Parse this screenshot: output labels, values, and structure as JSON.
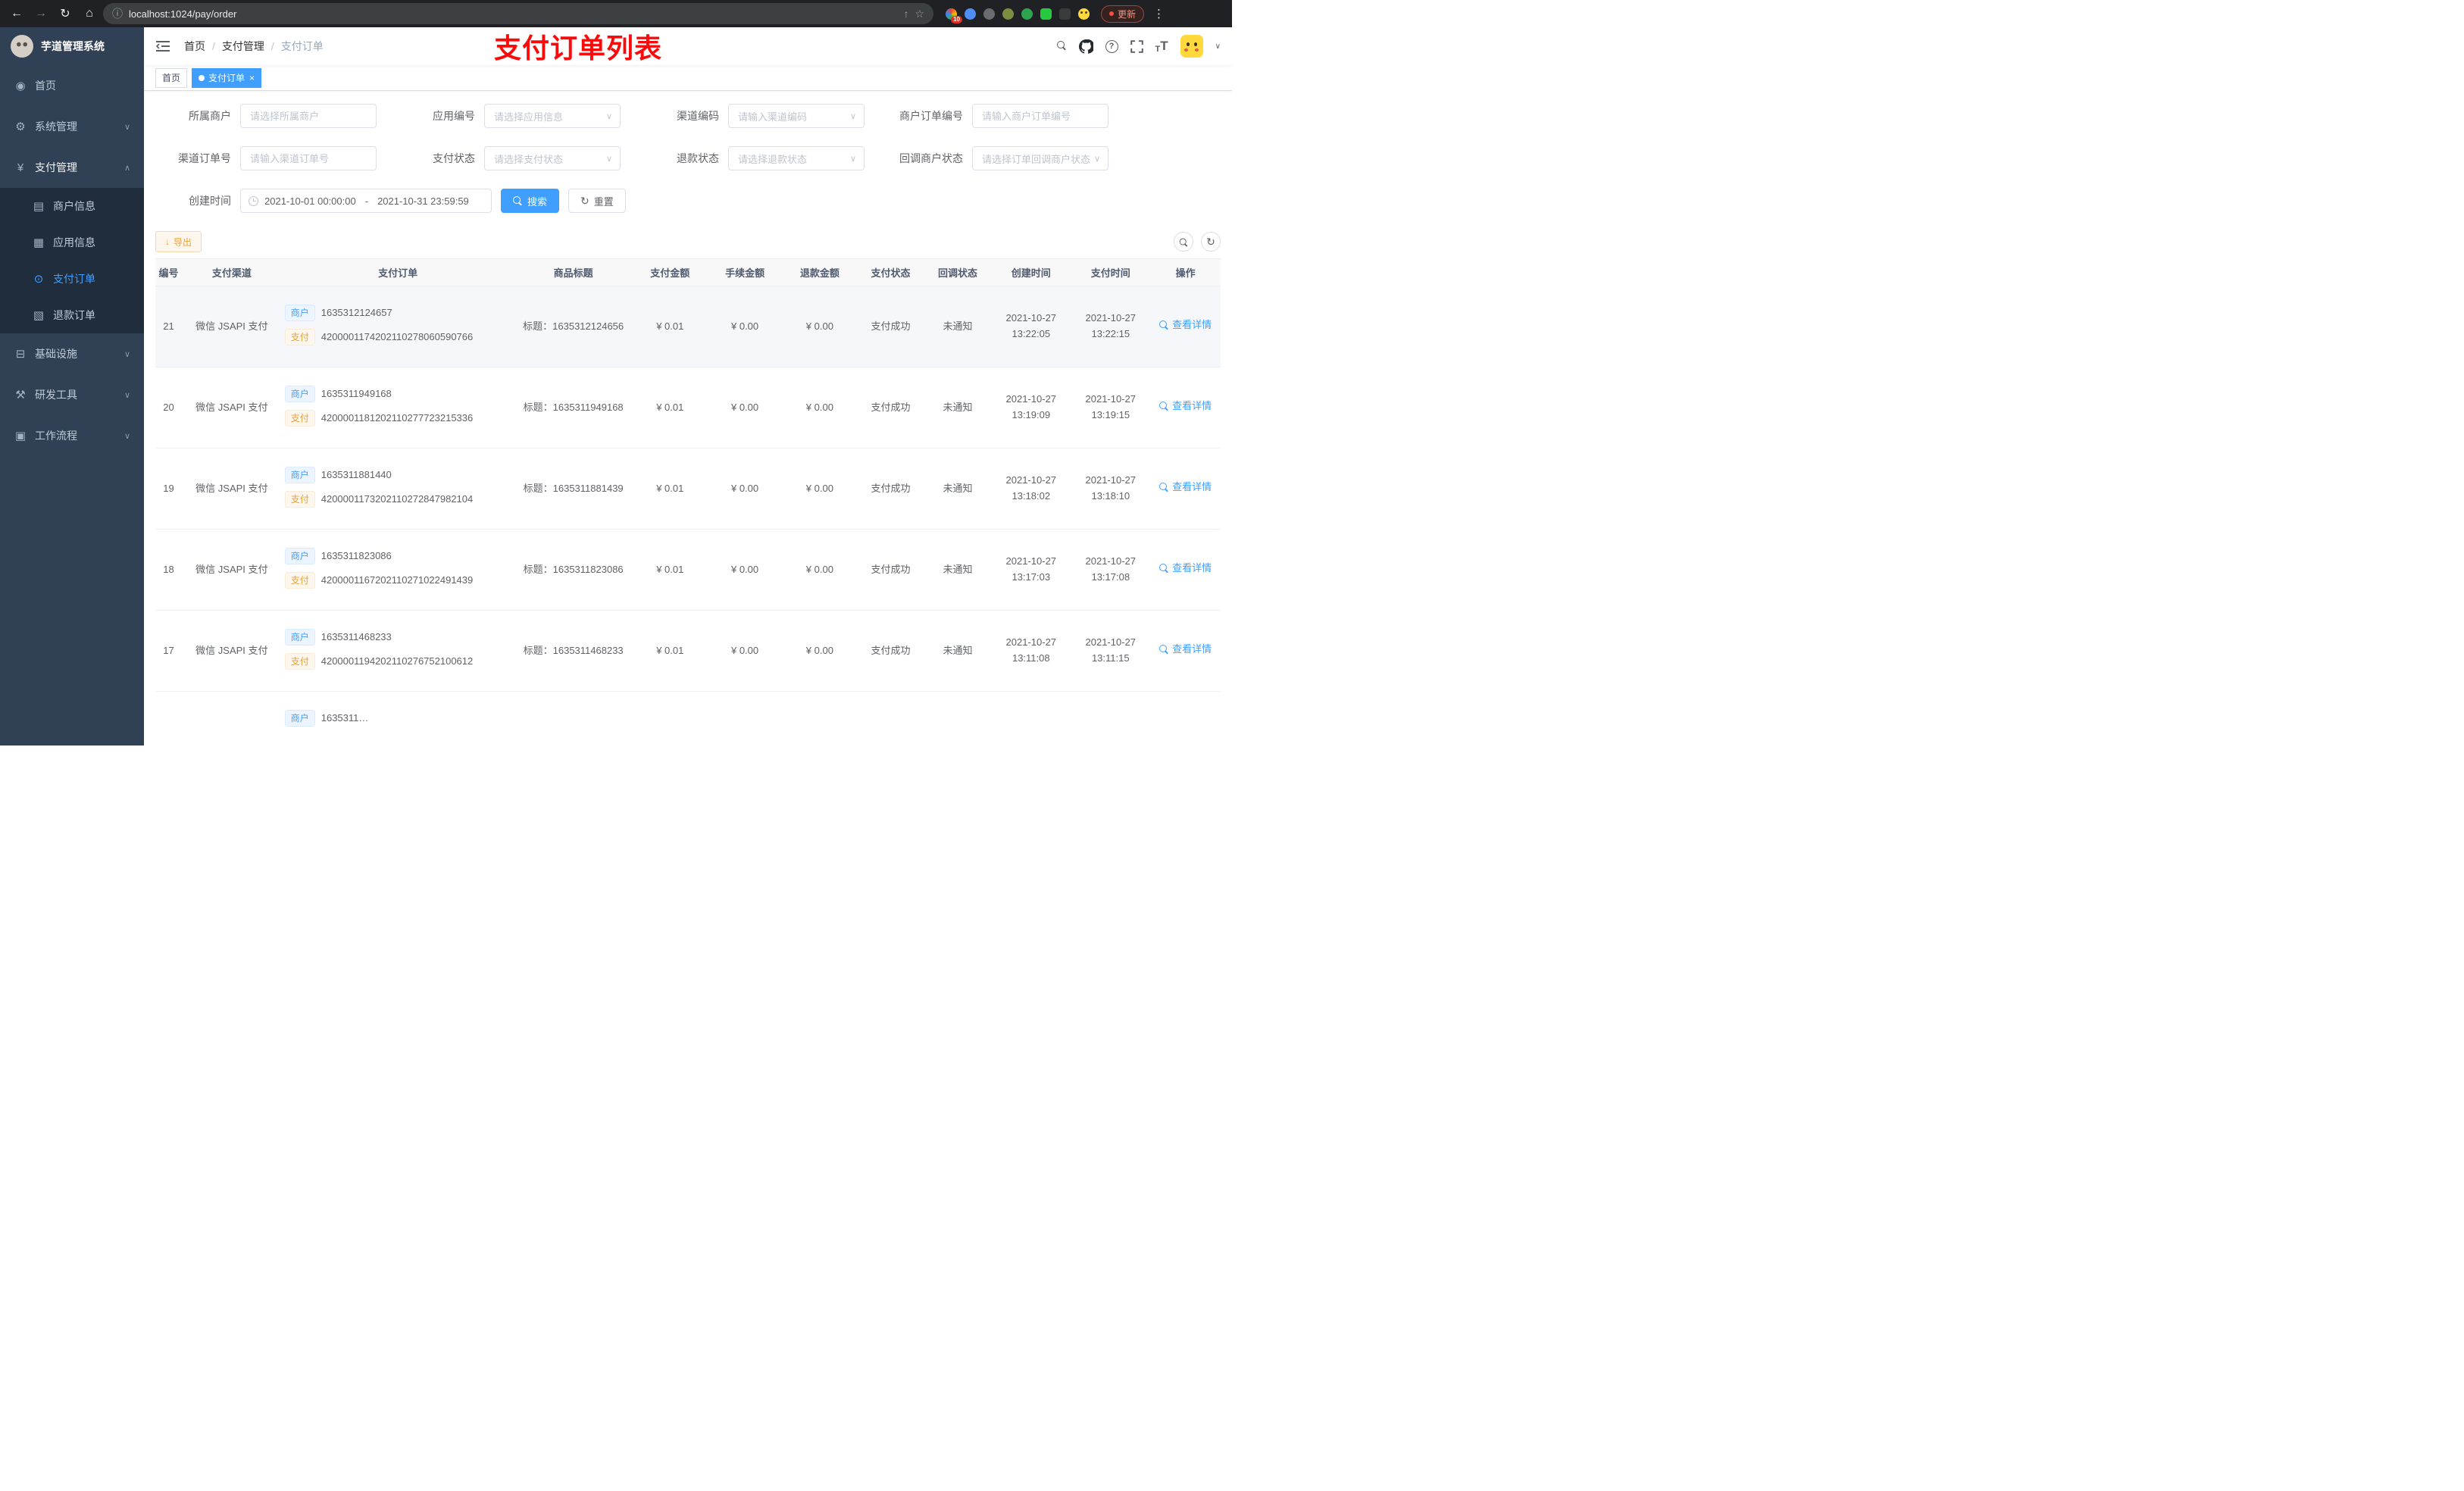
{
  "browser": {
    "url": "localhost:1024/pay/order",
    "update_label": "更新",
    "extension_badge": "10"
  },
  "sidebar": {
    "title": "芋道管理系统",
    "menu": [
      {
        "key": "home",
        "label": "首页",
        "icon": "dashboard"
      },
      {
        "key": "system",
        "label": "系统管理",
        "icon": "gear",
        "chevron": "down"
      },
      {
        "key": "payment",
        "label": "支付管理",
        "icon": "yen",
        "chevron": "up",
        "children": [
          {
            "key": "merchant-info",
            "label": "商户信息",
            "icon": "merchant-card"
          },
          {
            "key": "app-info",
            "label": "应用信息",
            "icon": "app-grid"
          },
          {
            "key": "pay-order",
            "label": "支付订单",
            "icon": "pay-order",
            "active": true
          },
          {
            "key": "refund-order",
            "label": "退款订单",
            "icon": "refund-doc"
          }
        ]
      },
      {
        "key": "infrastructure",
        "label": "基础设施",
        "icon": "infra",
        "chevron": "down"
      },
      {
        "key": "dev-tools",
        "label": "研发工具",
        "icon": "tools",
        "chevron": "down"
      },
      {
        "key": "workflow",
        "label": "工作流程",
        "icon": "workflow",
        "chevron": "down"
      }
    ]
  },
  "header": {
    "breadcrumb": [
      "首页",
      "支付管理",
      "支付订单"
    ],
    "annotation": "支付订单列表"
  },
  "tabs": [
    {
      "key": "home",
      "label": "首页",
      "active": false,
      "closable": false
    },
    {
      "key": "pay-order",
      "label": "支付订单",
      "active": true,
      "closable": true
    }
  ],
  "filters": {
    "row1": [
      {
        "label": "所属商户",
        "placeholder": "请选择所属商户",
        "type": "input"
      },
      {
        "label": "应用编号",
        "placeholder": "请选择应用信息",
        "type": "select"
      },
      {
        "label": "渠道编码",
        "placeholder": "请输入渠道编码",
        "type": "select"
      },
      {
        "label": "商户订单编号",
        "placeholder": "请输入商户订单编号",
        "type": "input"
      }
    ],
    "row2": [
      {
        "label": "渠道订单号",
        "placeholder": "请输入渠道订单号",
        "type": "input"
      },
      {
        "label": "支付状态",
        "placeholder": "请选择支付状态",
        "type": "select"
      },
      {
        "label": "退款状态",
        "placeholder": "请选择退款状态",
        "type": "select"
      },
      {
        "label": "回调商户状态",
        "placeholder": "请选择订单回调商户状态",
        "type": "select"
      }
    ],
    "date": {
      "label": "创建时间",
      "start": "2021-10-01 00:00:00",
      "separator": "-",
      "end": "2021-10-31 23:59:59"
    },
    "search_label": "搜索",
    "reset_label": "重置"
  },
  "toolbar": {
    "export_label": "导出"
  },
  "table": {
    "columns": [
      "编号",
      "支付渠道",
      "支付订单",
      "商品标题",
      "支付金额",
      "手续金额",
      "退款金额",
      "支付状态",
      "回调状态",
      "创建时间",
      "支付时间",
      "操作"
    ],
    "merchant_tag": "商户",
    "pay_tag": "支付",
    "action_label": "查看详情",
    "rows": [
      {
        "id": "21",
        "channel": "微信 JSAPI 支付",
        "merchant_no": "1635312124657",
        "pay_no": "4200001174202110278060590766",
        "title": "标题：1635312124656",
        "amount": "¥ 0.01",
        "fee": "¥ 0.00",
        "refund": "¥ 0.00",
        "status": "支付成功",
        "notify": "未通知",
        "create_time": "2021-10-27 13:22:05",
        "pay_time": "2021-10-27 13:22:15"
      },
      {
        "id": "20",
        "channel": "微信 JSAPI 支付",
        "merchant_no": "1635311949168",
        "pay_no": "4200001181202110277723215336",
        "title": "标题：1635311949168",
        "amount": "¥ 0.01",
        "fee": "¥ 0.00",
        "refund": "¥ 0.00",
        "status": "支付成功",
        "notify": "未通知",
        "create_time": "2021-10-27 13:19:09",
        "pay_time": "2021-10-27 13:19:15"
      },
      {
        "id": "19",
        "channel": "微信 JSAPI 支付",
        "merchant_no": "1635311881440",
        "pay_no": "4200001173202110272847982104",
        "title": "标题：1635311881439",
        "amount": "¥ 0.01",
        "fee": "¥ 0.00",
        "refund": "¥ 0.00",
        "status": "支付成功",
        "notify": "未通知",
        "create_time": "2021-10-27 13:18:02",
        "pay_time": "2021-10-27 13:18:10"
      },
      {
        "id": "18",
        "channel": "微信 JSAPI 支付",
        "merchant_no": "1635311823086",
        "pay_no": "4200001167202110271022491439",
        "title": "标题：1635311823086",
        "amount": "¥ 0.01",
        "fee": "¥ 0.00",
        "refund": "¥ 0.00",
        "status": "支付成功",
        "notify": "未通知",
        "create_time": "2021-10-27 13:17:03",
        "pay_time": "2021-10-27 13:17:08"
      },
      {
        "id": "17",
        "channel": "微信 JSAPI 支付",
        "merchant_no": "1635311468233",
        "pay_no": "4200001194202110276752100612",
        "title": "标题：1635311468233",
        "amount": "¥ 0.01",
        "fee": "¥ 0.00",
        "refund": "¥ 0.00",
        "status": "支付成功",
        "notify": "未通知",
        "create_time": "2021-10-27 13:11:08",
        "pay_time": "2021-10-27 13:11:15"
      },
      {
        "id": "",
        "channel": "",
        "merchant_no": "1635311…",
        "pay_no": "",
        "title": "",
        "amount": "",
        "fee": "",
        "refund": "",
        "status": "",
        "notify": "",
        "create_time": "",
        "pay_time": "",
        "partial": true
      }
    ]
  }
}
